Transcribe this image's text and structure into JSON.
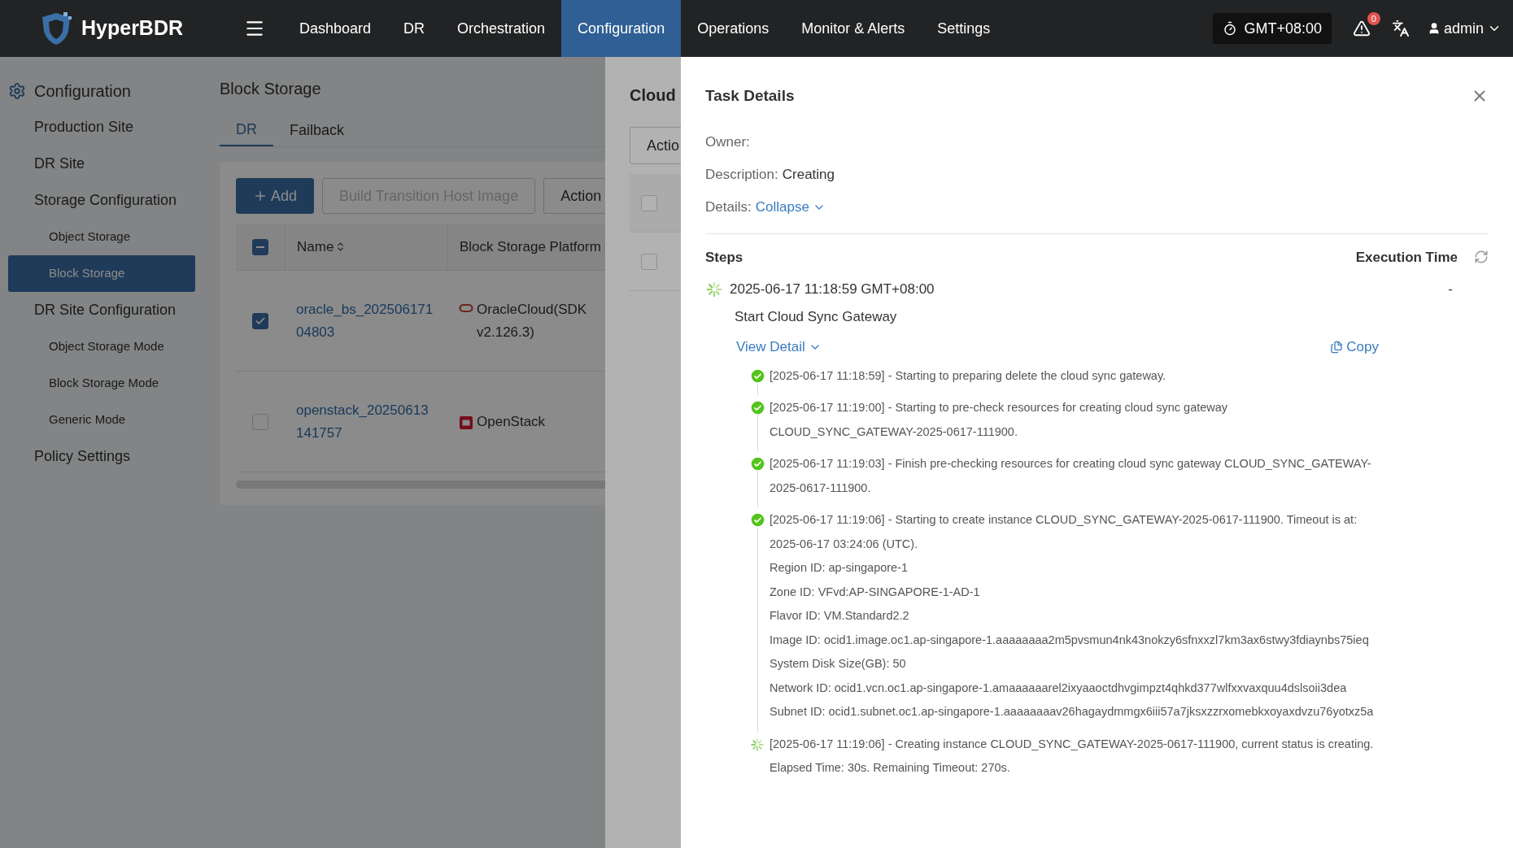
{
  "nav": {
    "logo": "HyperBDR",
    "items": [
      {
        "label": "Dashboard",
        "selected": false
      },
      {
        "label": "DR",
        "selected": false
      },
      {
        "label": "Orchestration",
        "selected": false
      },
      {
        "label": "Configuration",
        "selected": true
      },
      {
        "label": "Operations",
        "selected": false
      },
      {
        "label": "Monitor & Alerts",
        "selected": false
      },
      {
        "label": "Settings",
        "selected": false
      }
    ],
    "timezone": "GMT+08:00",
    "alert_count": "0",
    "user": "admin"
  },
  "sidebar": {
    "title": "Configuration",
    "items": [
      {
        "label": "Production Site",
        "selected": false
      },
      {
        "label": "DR Site",
        "selected": false
      },
      {
        "label": "Storage Configuration",
        "selected": false,
        "children": [
          {
            "label": "Object Storage",
            "selected": false
          },
          {
            "label": "Block Storage",
            "selected": true
          }
        ]
      },
      {
        "label": "DR Site Configuration",
        "selected": false,
        "children": [
          {
            "label": "Object Storage Mode",
            "selected": false
          },
          {
            "label": "Block Storage Mode",
            "selected": false
          },
          {
            "label": "Generic Mode",
            "selected": false
          }
        ]
      },
      {
        "label": "Policy Settings",
        "selected": false
      }
    ]
  },
  "main": {
    "title": "Block Storage",
    "tabs": [
      {
        "label": "DR",
        "selected": true
      },
      {
        "label": "Failback",
        "selected": false
      }
    ],
    "buttons": [
      {
        "label": "Add",
        "kind": "primary",
        "disabled": false
      },
      {
        "label": "Build Transition Host Image",
        "kind": "default",
        "disabled": true
      },
      {
        "label": "Action",
        "kind": "default",
        "disabled": false
      }
    ],
    "table": {
      "header_partial": true,
      "columns": [
        "Name",
        "Block Storage Platform"
      ],
      "rows": [
        {
          "checked": true,
          "name": "oracle_bs_20250617104803",
          "platform": "OracleCloud(SDK v2.126.3)",
          "kind": "oracle"
        },
        {
          "checked": false,
          "name": "openstack_20250613141757",
          "platform": "OpenStack",
          "kind": "openstack"
        }
      ]
    }
  },
  "back_drawer": {
    "title": "Cloud",
    "button": "Actio",
    "rows": [
      {
        "checked": false
      },
      {
        "checked": false
      }
    ]
  },
  "task": {
    "title": "Task Details",
    "fields": [
      {
        "label": "Owner:",
        "kind": "text"
      },
      {
        "label": "Description:",
        "value": "Creating",
        "kind": "text"
      },
      {
        "label": "Details:",
        "value": "Collapse",
        "kind": "link"
      }
    ],
    "steps_header": "Steps",
    "time_header": "Execution Time",
    "steps": [
      {
        "done": false,
        "time": "2025-06-17 11:18:59 GMT+08:00",
        "name": "Start Cloud Sync Gateway",
        "execution_time": "-",
        "view_detail": "View Detail",
        "copy": "Copy",
        "logs": [
          {
            "done": true,
            "lines": [
              "[2025-06-17 11:18:59] - Starting to preparing delete the cloud sync gateway."
            ]
          },
          {
            "done": true,
            "lines": [
              "[2025-06-17 11:19:00] - Starting to pre-check resources for creating cloud sync gateway CLOUD_SYNC_GATEWAY-2025-0617-111900."
            ]
          },
          {
            "done": true,
            "lines": [
              "[2025-06-17 11:19:03] - Finish pre-checking resources for creating cloud sync gateway CLOUD_SYNC_GATEWAY-2025-0617-111900."
            ]
          },
          {
            "done": true,
            "lines": [
              "[2025-06-17 11:19:06] - Starting to create instance CLOUD_SYNC_GATEWAY-2025-0617-111900. Timeout is at: 2025-06-17 03:24:06 (UTC).",
              "Region ID: ap-singapore-1",
              "Zone ID: VFvd:AP-SINGAPORE-1-AD-1",
              "Flavor ID: VM.Standard2.2",
              "Image ID: ocid1.image.oc1.ap-singapore-1.aaaaaaaa2m5pvsmun4nk43nokzy6sfnxxzl7km3ax6stwy3fdiaynbs75ieq",
              "System Disk Size(GB): 50",
              "Network ID: ocid1.vcn.oc1.ap-singapore-1.amaaaaaarel2ixyaaoctdhvgimpzt4qhkd377wlfxxvaxquu4dslsoii3dea",
              "Subnet ID: ocid1.subnet.oc1.ap-singapore-1.aaaaaaaav26hagaydmmgx6iii57a7jksxzzrxomebkxoyaxdvzu76yotxz5a"
            ]
          },
          {
            "done": false,
            "lines": [
              "[2025-06-17 11:19:06] - Creating instance CLOUD_SYNC_GATEWAY-2025-0617-111900, current status is creating.",
              "Elapsed Time: 30s. Remaining Timeout: 270s."
            ]
          }
        ]
      }
    ]
  }
}
